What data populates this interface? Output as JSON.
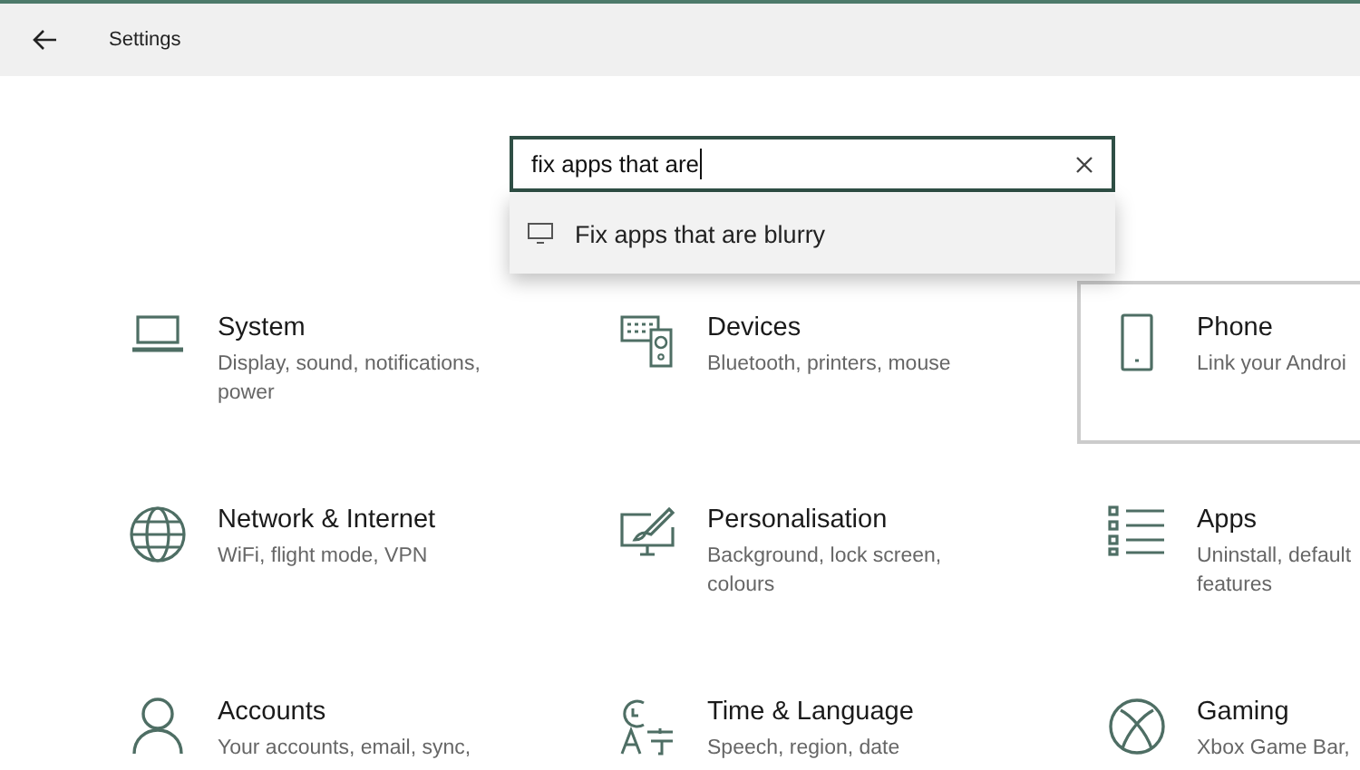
{
  "window": {
    "title": "Settings"
  },
  "search": {
    "value": "fix apps that are"
  },
  "suggestions": [
    {
      "kind": "display",
      "label": "Fix apps that are blurry"
    }
  ],
  "categories": [
    {
      "kind": "laptop",
      "title": "System",
      "description": "Display, sound, notifications, power",
      "selected": false
    },
    {
      "kind": "devices",
      "title": "Devices",
      "description": "Bluetooth, printers, mouse",
      "selected": false
    },
    {
      "kind": "phone",
      "title": "Phone",
      "description": "Link your Androi",
      "selected": true
    },
    {
      "kind": "globe",
      "title": "Network & Internet",
      "description": "WiFi, flight mode, VPN",
      "selected": false
    },
    {
      "kind": "brush",
      "title": "Personalisation",
      "description": "Background, lock screen, colours",
      "selected": false
    },
    {
      "kind": "apps",
      "title": "Apps",
      "description": "Uninstall, default features",
      "selected": false
    },
    {
      "kind": "person",
      "title": "Accounts",
      "description": "Your accounts, email, sync,",
      "selected": false
    },
    {
      "kind": "language",
      "title": "Time & Language",
      "description": "Speech, region, date",
      "selected": false
    },
    {
      "kind": "xbox",
      "title": "Gaming",
      "description": "Xbox Game Bar,",
      "selected": false
    }
  ]
}
